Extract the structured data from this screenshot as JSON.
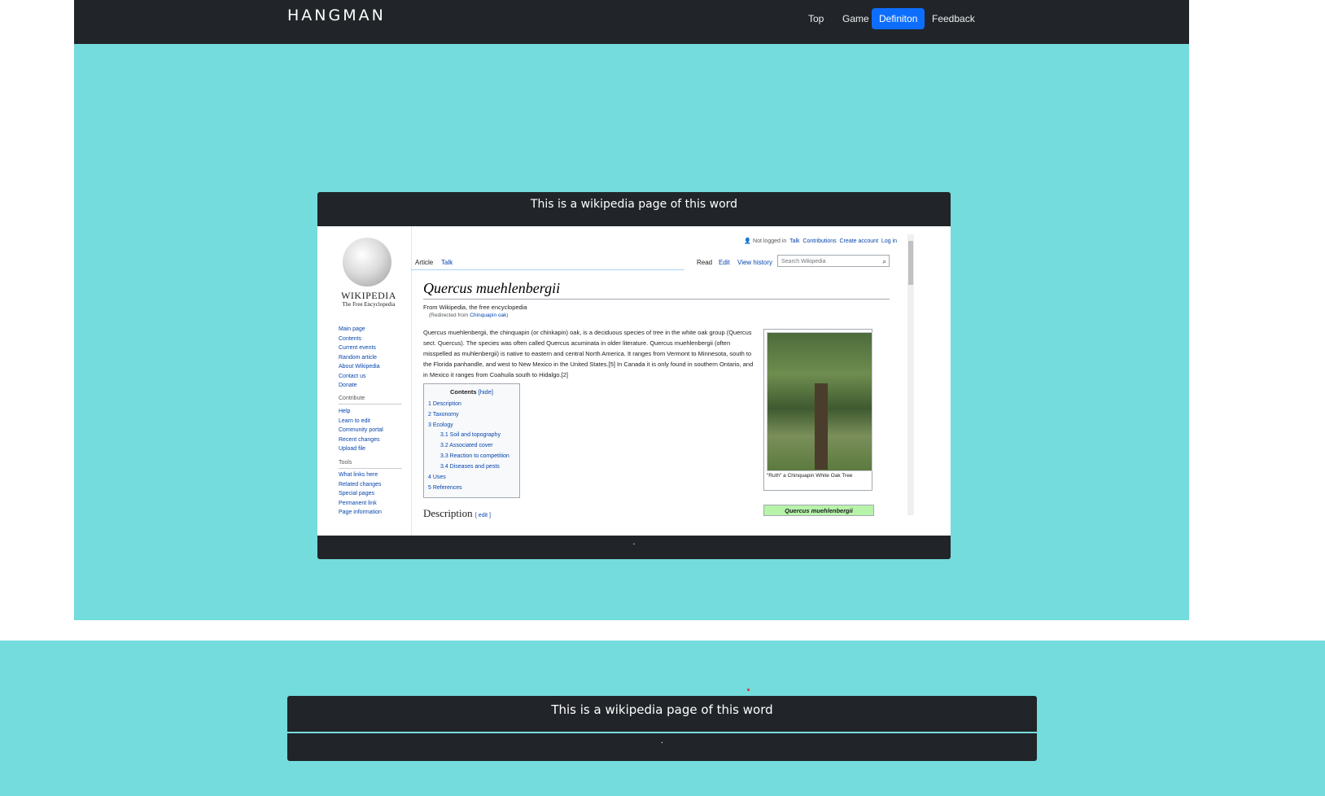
{
  "navbar": {
    "brand": "HANGMAN",
    "links": [
      {
        "label": "Top"
      },
      {
        "label": "Game"
      },
      {
        "label": "Definiton",
        "active": true
      },
      {
        "label": "Feedback"
      }
    ],
    "active_color": "#0d6efd"
  },
  "colors": {
    "page_bg": "#74dcdc",
    "navbar_bg": "#212529"
  },
  "card_top": {
    "header": "This is a wikipedia page of this word",
    "footer": "."
  },
  "wiki": {
    "logo_text": "WIKIPEDIA",
    "logo_sub": "The Free Encyclopedia",
    "nav_items": [
      "Main page",
      "Contents",
      "Current events",
      "Random article",
      "About Wikipedia",
      "Contact us",
      "Donate"
    ],
    "contribute_head": "Contribute",
    "contribute_items": [
      "Help",
      "Learn to edit",
      "Community portal",
      "Recent changes",
      "Upload file"
    ],
    "tools_head": "Tools",
    "tools_items": [
      "What links here",
      "Related changes",
      "Special pages",
      "Permanent link",
      "Page information"
    ],
    "top_links": {
      "not_logged": "Not logged in",
      "talk": "Talk",
      "contributions": "Contributions",
      "create": "Create account",
      "login": "Log in"
    },
    "tabs": {
      "article": "Article",
      "talk": "Talk",
      "read": "Read",
      "edit": "Edit",
      "history": "View history"
    },
    "search_placeholder": "Search Wikipedia",
    "title": "Quercus muehlenbergii",
    "from": "From Wikipedia, the free encyclopedia",
    "redirect_prefix": "(Redirected from ",
    "redirect_link": "Chinquapin oak",
    "redirect_suffix": ")",
    "paragraph": "Quercus muehlenbergii, the chinquapin (or chinkapin) oak, is a deciduous species of tree in the white oak group (Quercus sect. Quercus). The species was often called Quercus acuminata in older literature. Quercus muehlenbergii (often misspelled as muhlenbergii) is native to eastern and central North America. It ranges from Vermont to Minnesota, south to the Florida panhandle, and west to New Mexico in the United States.[5] In Canada it is only found in southern Ontario, and in Mexico it ranges from Coahuila south to Hidalgo.[2]",
    "toc": {
      "title": "Contents",
      "hide": "[hide]",
      "items": [
        "1  Description",
        "2  Taxonomy",
        "3  Ecology",
        "3.1  Soil and topography",
        "3.2  Associated cover",
        "3.3  Reaction to competition",
        "3.4  Diseases and pests",
        "4  Uses",
        "5  References"
      ]
    },
    "image_caption": "\"Ruth\" a Chinquapin White Oak Tree",
    "taxobox": "Quercus muehlenbergii",
    "section_heading": "Description",
    "section_edit": "[ edit ]"
  },
  "card_bottom": {
    "header": "This is a wikipedia page of this word",
    "footer": "."
  }
}
